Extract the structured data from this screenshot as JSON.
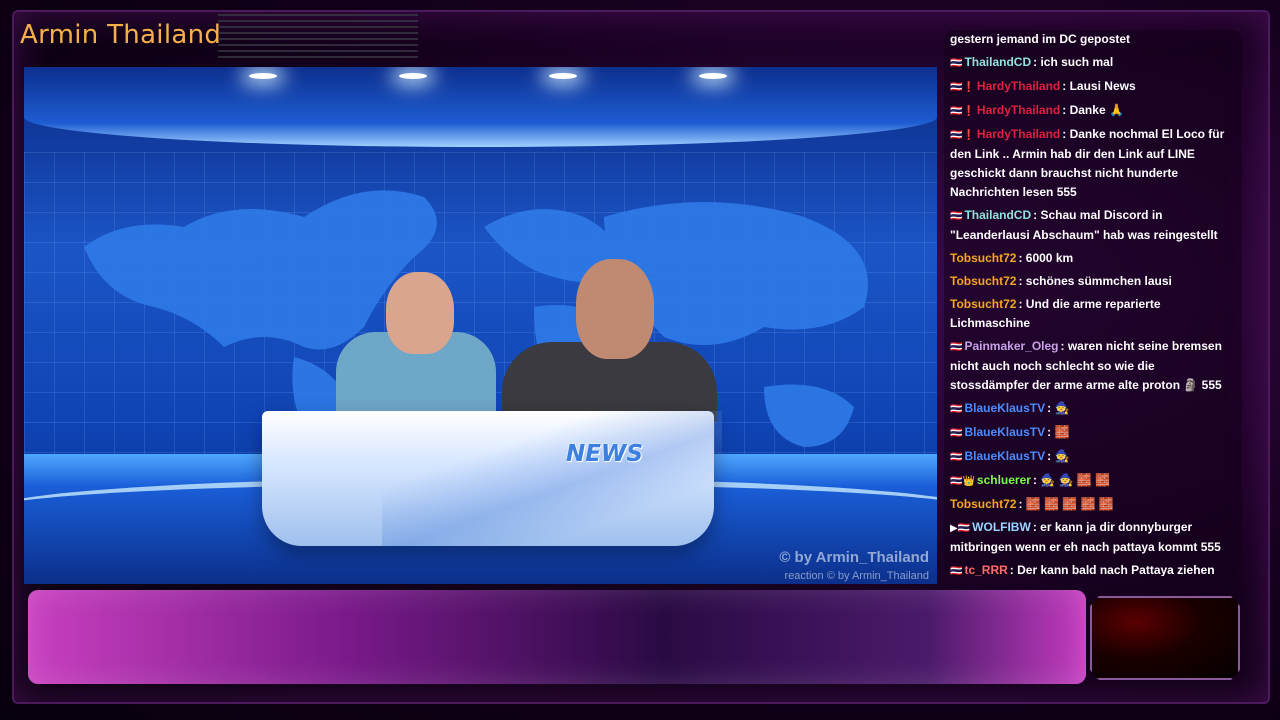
{
  "channel": {
    "title": "Armin Thailand"
  },
  "video": {
    "desk_label": "NEWS",
    "watermark": "© by Armin_Thailand",
    "watermark_small": "reaction  © by Armin_Thailand"
  },
  "chat": {
    "messages": [
      {
        "badges": "",
        "user": "",
        "user_color": "#ffffff",
        "text": "gestern jemand im DC gepostet"
      },
      {
        "badges": "🇹🇭",
        "user": "ThailandCD",
        "user_color": "#8fe3d8",
        "text": ": ich such mal"
      },
      {
        "badges": "🇹🇭❗",
        "user": "HardyThailand",
        "user_color": "#e0203c",
        "text": ": Lausi News"
      },
      {
        "badges": "🇹🇭❗",
        "user": "HardyThailand",
        "user_color": "#e0203c",
        "text": ": Danke 🙏"
      },
      {
        "badges": "🇹🇭❗",
        "user": "HardyThailand",
        "user_color": "#e0203c",
        "text": ": Danke nochmal El Loco für den Link .. Armin hab dir den Link auf LINE geschickt dann brauchst nicht hunderte Nachrichten lesen 555"
      },
      {
        "badges": "🇹🇭",
        "user": "ThailandCD",
        "user_color": "#8fe3d8",
        "text": ": Schau mal Discord in \"Leanderlausi Abschaum\" hab was reingestellt"
      },
      {
        "badges": "",
        "user": "Tobsucht72",
        "user_color": "#f5a623",
        "text": ": 6000 km"
      },
      {
        "badges": "",
        "user": "Tobsucht72",
        "user_color": "#f5a623",
        "text": ": schönes sümmchen lausi"
      },
      {
        "badges": "",
        "user": "Tobsucht72",
        "user_color": "#f5a623",
        "text": ": Und die arme reparierte Lichmaschine"
      },
      {
        "badges": "🇹🇭",
        "user": "Painmaker_Oleg",
        "user_color": "#c9a0e8",
        "text": ": waren nicht seine bremsen nicht auch noch schlecht so wie die stossdämpfer der arme arme alte proton 🗿 555"
      },
      {
        "badges": "🇹🇭",
        "user": "BlaueKlausTV",
        "user_color": "#4a8cff",
        "text": ": 🧙"
      },
      {
        "badges": "🇹🇭",
        "user": "BlaueKlausTV",
        "user_color": "#4a8cff",
        "text": ": 🧱"
      },
      {
        "badges": "🇹🇭",
        "user": "BlaueKlausTV",
        "user_color": "#4a8cff",
        "text": ": 🧙"
      },
      {
        "badges": "🇹🇭👑",
        "user": "schluerer",
        "user_color": "#7cff4a",
        "text": ": 🧙 🧙 🧱 🧱"
      },
      {
        "badges": "",
        "user": "Tobsucht72",
        "user_color": "#f5a623",
        "text": ": 🧱 🧱 🧱 🧱 🧱"
      },
      {
        "badges": "▶🇹🇭",
        "user": "WOLFIBW",
        "user_color": "#9ad6ff",
        "text": ": er kann ja dir donnyburger mitbringen wenn er eh nach pattaya kommt 555"
      },
      {
        "badges": "🇹🇭",
        "user": "tc_RRR",
        "user_color": "#ff6a6a",
        "text": ": Der kann bald nach Pattaya ziehen"
      }
    ]
  },
  "colors": {
    "title": "#f5b04a",
    "studio_blue": "#1b55c6",
    "overlay_magenta": "#c83fbf"
  }
}
